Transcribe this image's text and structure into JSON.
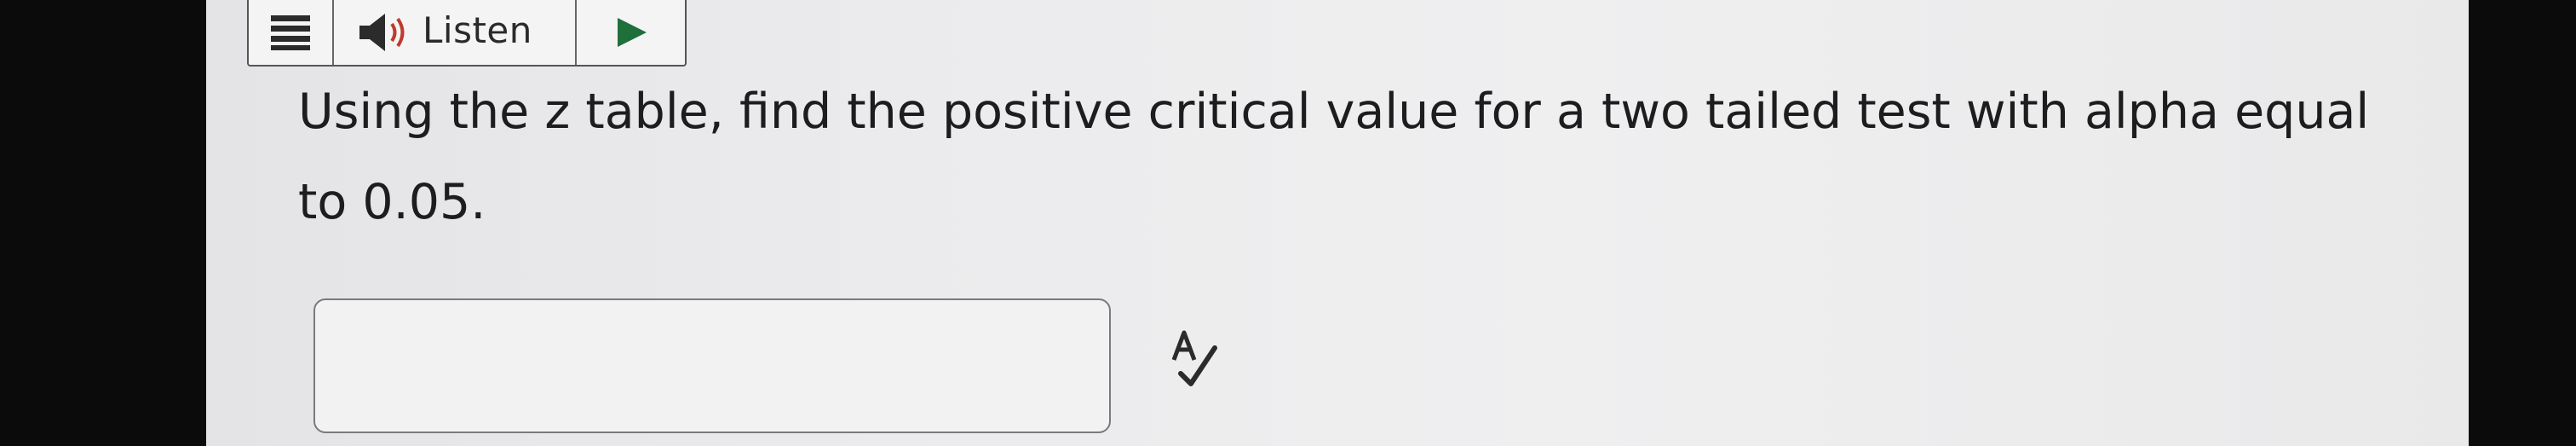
{
  "toolbar": {
    "menu_icon": "menu-lines-icon",
    "speaker_icon": "speaker-icon",
    "listen_label": "Listen",
    "play_icon": "play-icon"
  },
  "question": {
    "text": "Using the z table, find the positive critical value for a two tailed test with alpha equal to 0.05."
  },
  "answer": {
    "value": "",
    "placeholder": ""
  },
  "spell_check_icon": "spell-check-icon",
  "colors": {
    "accent_play": "#1f6f3a",
    "speaker_wave": "#c0392b",
    "text": "#1d1d1f"
  }
}
